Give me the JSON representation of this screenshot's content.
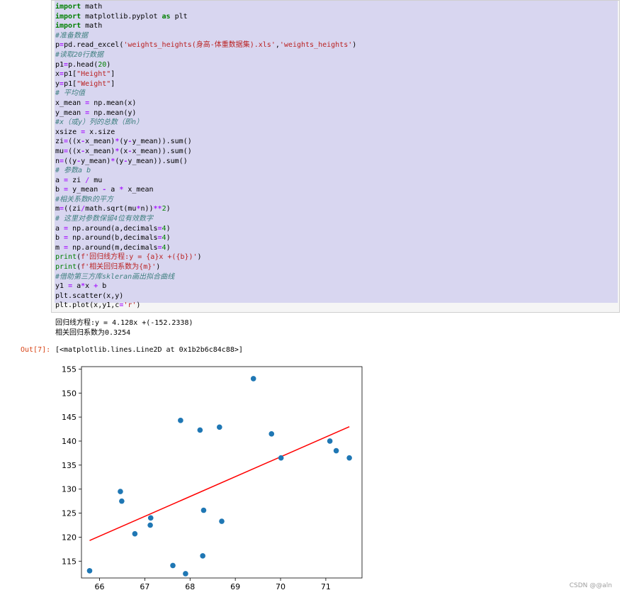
{
  "code_cell": {
    "lines": [
      [
        {
          "t": "import",
          "c": "kw"
        },
        {
          "t": " math",
          "c": ""
        }
      ],
      [
        {
          "t": "import",
          "c": "kw"
        },
        {
          "t": " matplotlib.pyplot ",
          "c": ""
        },
        {
          "t": "as",
          "c": "kw"
        },
        {
          "t": " plt",
          "c": ""
        }
      ],
      [
        {
          "t": "import",
          "c": "kw"
        },
        {
          "t": " math",
          "c": ""
        }
      ],
      [
        {
          "t": "#准备数据",
          "c": "cm"
        }
      ],
      [
        {
          "t": "p",
          "c": ""
        },
        {
          "t": "=",
          "c": "op"
        },
        {
          "t": "pd.read_excel(",
          "c": ""
        },
        {
          "t": "'weights_heights(身高-体重数据集).xls'",
          "c": "st"
        },
        {
          "t": ",",
          "c": ""
        },
        {
          "t": "'weights_heights'",
          "c": "st"
        },
        {
          "t": ")",
          "c": ""
        }
      ],
      [
        {
          "t": "#读取20行数据",
          "c": "cm"
        }
      ],
      [
        {
          "t": "p1",
          "c": ""
        },
        {
          "t": "=",
          "c": "op"
        },
        {
          "t": "p.head(",
          "c": ""
        },
        {
          "t": "20",
          "c": "nm"
        },
        {
          "t": ")",
          "c": ""
        }
      ],
      [
        {
          "t": "x",
          "c": ""
        },
        {
          "t": "=",
          "c": "op"
        },
        {
          "t": "p1[",
          "c": ""
        },
        {
          "t": "\"Height\"",
          "c": "st"
        },
        {
          "t": "]",
          "c": ""
        }
      ],
      [
        {
          "t": "y",
          "c": ""
        },
        {
          "t": "=",
          "c": "op"
        },
        {
          "t": "p1[",
          "c": ""
        },
        {
          "t": "\"Weight\"",
          "c": "st"
        },
        {
          "t": "]",
          "c": ""
        }
      ],
      [
        {
          "t": "# 平均值",
          "c": "cm"
        }
      ],
      [
        {
          "t": "x_mean ",
          "c": ""
        },
        {
          "t": "=",
          "c": "op"
        },
        {
          "t": " np.mean(x)",
          "c": ""
        }
      ],
      [
        {
          "t": "y_mean ",
          "c": ""
        },
        {
          "t": "=",
          "c": "op"
        },
        {
          "t": " np.mean(y)",
          "c": ""
        }
      ],
      [
        {
          "t": "#x（或y）列的总数（即n）",
          "c": "cm"
        }
      ],
      [
        {
          "t": "xsize ",
          "c": ""
        },
        {
          "t": "=",
          "c": "op"
        },
        {
          "t": " x.size",
          "c": ""
        }
      ],
      [
        {
          "t": "zi",
          "c": ""
        },
        {
          "t": "=",
          "c": "op"
        },
        {
          "t": "((x",
          "c": ""
        },
        {
          "t": "-",
          "c": "op"
        },
        {
          "t": "x_mean)",
          "c": ""
        },
        {
          "t": "*",
          "c": "op"
        },
        {
          "t": "(y",
          "c": ""
        },
        {
          "t": "-",
          "c": "op"
        },
        {
          "t": "y_mean)).sum()",
          "c": ""
        }
      ],
      [
        {
          "t": "mu",
          "c": ""
        },
        {
          "t": "=",
          "c": "op"
        },
        {
          "t": "((x",
          "c": ""
        },
        {
          "t": "-",
          "c": "op"
        },
        {
          "t": "x_mean)",
          "c": ""
        },
        {
          "t": "*",
          "c": "op"
        },
        {
          "t": "(x",
          "c": ""
        },
        {
          "t": "-",
          "c": "op"
        },
        {
          "t": "x_mean)).sum()",
          "c": ""
        }
      ],
      [
        {
          "t": "n",
          "c": ""
        },
        {
          "t": "=",
          "c": "op"
        },
        {
          "t": "((y",
          "c": ""
        },
        {
          "t": "-",
          "c": "op"
        },
        {
          "t": "y_mean)",
          "c": ""
        },
        {
          "t": "*",
          "c": "op"
        },
        {
          "t": "(y",
          "c": ""
        },
        {
          "t": "-",
          "c": "op"
        },
        {
          "t": "y_mean)).sum()",
          "c": ""
        }
      ],
      [
        {
          "t": "# 参数a b",
          "c": "cm"
        }
      ],
      [
        {
          "t": "a ",
          "c": ""
        },
        {
          "t": "=",
          "c": "op"
        },
        {
          "t": " zi ",
          "c": ""
        },
        {
          "t": "/",
          "c": "op"
        },
        {
          "t": " mu",
          "c": ""
        }
      ],
      [
        {
          "t": "b ",
          "c": ""
        },
        {
          "t": "=",
          "c": "op"
        },
        {
          "t": " y_mean ",
          "c": ""
        },
        {
          "t": "-",
          "c": "op"
        },
        {
          "t": " a ",
          "c": ""
        },
        {
          "t": "*",
          "c": "op"
        },
        {
          "t": " x_mean",
          "c": ""
        }
      ],
      [
        {
          "t": "#相关系数R的平方",
          "c": "cm"
        }
      ],
      [
        {
          "t": "m",
          "c": ""
        },
        {
          "t": "=",
          "c": "op"
        },
        {
          "t": "((zi",
          "c": ""
        },
        {
          "t": "/",
          "c": "op"
        },
        {
          "t": "math.sqrt(mu",
          "c": ""
        },
        {
          "t": "*",
          "c": "op"
        },
        {
          "t": "n))",
          "c": ""
        },
        {
          "t": "**",
          "c": "op"
        },
        {
          "t": "2",
          "c": "nm"
        },
        {
          "t": ")",
          "c": ""
        }
      ],
      [
        {
          "t": "# 这里对参数保留4位有效数字",
          "c": "cm"
        }
      ],
      [
        {
          "t": "a ",
          "c": ""
        },
        {
          "t": "=",
          "c": "op"
        },
        {
          "t": " np.around(a,decimals",
          "c": ""
        },
        {
          "t": "=",
          "c": "op"
        },
        {
          "t": "4",
          "c": "nm"
        },
        {
          "t": ")",
          "c": ""
        }
      ],
      [
        {
          "t": "b ",
          "c": ""
        },
        {
          "t": "=",
          "c": "op"
        },
        {
          "t": " np.around(b,decimals",
          "c": ""
        },
        {
          "t": "=",
          "c": "op"
        },
        {
          "t": "4",
          "c": "nm"
        },
        {
          "t": ")",
          "c": ""
        }
      ],
      [
        {
          "t": "m ",
          "c": ""
        },
        {
          "t": "=",
          "c": "op"
        },
        {
          "t": " np.around(m,decimals",
          "c": ""
        },
        {
          "t": "=",
          "c": "op"
        },
        {
          "t": "4",
          "c": "nm"
        },
        {
          "t": ")",
          "c": ""
        }
      ],
      [
        {
          "t": "print",
          "c": "nb"
        },
        {
          "t": "(",
          "c": ""
        },
        {
          "t": "f'回归线方程:y = {a}x +({b})'",
          "c": "st"
        },
        {
          "t": ")",
          "c": ""
        }
      ],
      [
        {
          "t": "print",
          "c": "nb"
        },
        {
          "t": "(",
          "c": ""
        },
        {
          "t": "f'相关回归系数为{m}'",
          "c": "st"
        },
        {
          "t": ")",
          "c": ""
        }
      ],
      [
        {
          "t": "#借助第三方库skleran画出拟合曲线",
          "c": "cm"
        }
      ],
      [
        {
          "t": "y1 ",
          "c": ""
        },
        {
          "t": "=",
          "c": "op"
        },
        {
          "t": " a",
          "c": ""
        },
        {
          "t": "*",
          "c": "op"
        },
        {
          "t": "x ",
          "c": ""
        },
        {
          "t": "+",
          "c": "op"
        },
        {
          "t": " b",
          "c": ""
        }
      ],
      [
        {
          "t": "plt.scatter(x,y)",
          "c": ""
        }
      ],
      [
        {
          "t": "plt.plot(x,y1,c",
          "c": ""
        },
        {
          "t": "=",
          "c": "op"
        },
        {
          "t": "'r'",
          "c": "st"
        },
        {
          "t": ")",
          "c": ""
        }
      ]
    ]
  },
  "stdout": {
    "line1": "回归线方程:y = 4.128x +(-152.2338)",
    "line2": "相关回归系数为0.3254"
  },
  "out_prompt": "Out[7]:",
  "out_value": "[<matplotlib.lines.Line2D at 0x1b2b6c84c88>]",
  "watermark": "CSDN @@aln",
  "colors": {
    "scatter": "#1f77b4",
    "line": "#ff0000",
    "out_prompt": "#d84315"
  },
  "chart_data": {
    "type": "scatter",
    "title": "",
    "xlabel": "",
    "ylabel": "",
    "xlim": [
      65.6,
      71.8
    ],
    "ylim": [
      111.5,
      155.5
    ],
    "xticks": [
      66,
      67,
      68,
      69,
      70,
      71
    ],
    "yticks": [
      115,
      120,
      125,
      130,
      135,
      140,
      145,
      150,
      155
    ],
    "grid": false,
    "series": [
      {
        "kind": "scatter",
        "x": [
          65.78,
          71.52,
          69.4,
          68.22,
          67.79,
          68.7,
          69.8,
          70.01,
          67.9,
          66.78,
          66.49,
          67.62,
          68.3,
          67.12,
          68.28,
          71.09,
          66.46,
          68.65,
          71.23,
          67.13
        ],
        "y": [
          113.0,
          136.5,
          153.0,
          142.3,
          144.3,
          123.3,
          141.5,
          136.5,
          112.4,
          120.7,
          127.5,
          114.1,
          125.6,
          122.5,
          116.1,
          140.0,
          129.5,
          142.9,
          138.0,
          124.0
        ]
      },
      {
        "kind": "line",
        "x": [
          65.78,
          71.52
        ],
        "y": [
          119.3,
          142.99
        ]
      }
    ]
  }
}
